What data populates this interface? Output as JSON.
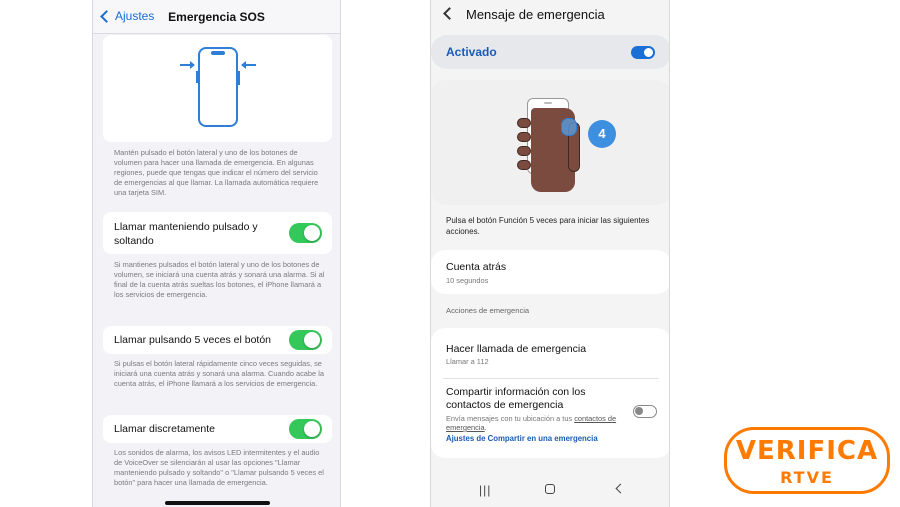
{
  "ios": {
    "back_label": "Ajustes",
    "title": "Emergencia SOS",
    "footnote_1": "Mantén pulsado el botón lateral y uno de los botones de volumen para hacer una llamada de emergencia. En algunas regiones, puede que tengas que indicar el número del servicio de emergencias al que llamar. La llamada automática requiere una tarjeta SIM.",
    "rows": [
      {
        "label": "Llamar manteniendo pulsado y soltando",
        "enabled": true,
        "footnote": "Si mantienes pulsados el botón lateral y uno de los botones de volumen, se iniciará una cuenta atrás y sonará una alarma. Si al final de la cuenta atrás sueltas los botones, el iPhone llamará a los servicios de emergencia."
      },
      {
        "label": "Llamar pulsando 5 veces el botón",
        "enabled": true,
        "footnote": "Si pulsas el botón lateral rápidamente cinco veces seguidas, se iniciará una cuenta atrás y sonará una alarma. Cuando acabe la cuenta atrás, el iPhone llamará a los servicios de emergencia."
      },
      {
        "label": "Llamar discretamente",
        "enabled": true,
        "footnote": "Los sonidos de alarma, los avisos LED intermitentes y el audio de VoiceOver se silenciarán al usar las opciones \"Llamar manteniendo pulsado y soltando\" o \"Llamar pulsando 5 veces el botón\" para hacer una llamada de emergencia."
      }
    ],
    "colors": {
      "accent": "#1a6cd6",
      "toggle_on": "#34c759"
    }
  },
  "android": {
    "title": "Mensaje de emergencia",
    "activado_label": "Activado",
    "activado_on": true,
    "press_count": "4",
    "description": "Pulsa el botón Función 5 veces para iniciar las siguientes acciones.",
    "countdown": {
      "title": "Cuenta atrás",
      "value": "10 segundos"
    },
    "section_label": "Acciones de emergencia",
    "call": {
      "title": "Hacer llamada de emergencia",
      "subtitle": "Llamar a 112"
    },
    "share": {
      "title": "Compartir información con los contactos de emergencia",
      "subtitle_prefix": "Envía mensajes con tu ubicación a tus",
      "subtitle_link": "contactos de emergencia",
      "subtitle_suffix": ".",
      "enabled": false,
      "settings_link": "Ajustes de Compartir en una emergencia"
    },
    "nav": {
      "recents": "|||"
    },
    "colors": {
      "accent": "#1a5bb5",
      "switch_on": "#1a6fd6"
    }
  },
  "watermark": {
    "line1": "VERIFICA",
    "line2": "RTVE",
    "color": "#ff7a00"
  }
}
